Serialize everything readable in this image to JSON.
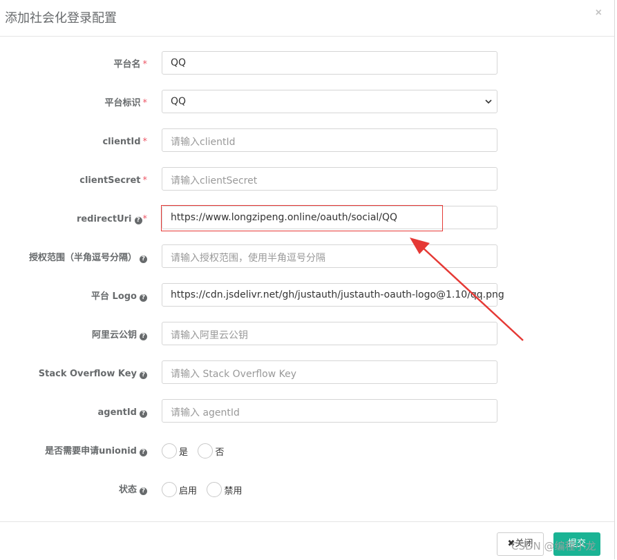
{
  "modal": {
    "title": "添加社会化登录配置",
    "close_symbol": "×"
  },
  "fields": {
    "platform_name": {
      "label": "平台名",
      "value": "QQ"
    },
    "platform_id": {
      "label": "平台标识",
      "value": "QQ"
    },
    "client_id": {
      "label": "clientId",
      "placeholder": "请输入clientId"
    },
    "client_secret": {
      "label": "clientSecret",
      "placeholder": "请输入clientSecret"
    },
    "redirect_uri": {
      "label": "redirectUri",
      "value": "https://www.longzipeng.online/oauth/social/QQ"
    },
    "scope": {
      "label": "授权范围（半角逗号分隔）",
      "placeholder": "请输入授权范围，使用半角逗号分隔"
    },
    "logo": {
      "label": "平台 Logo",
      "value": "https://cdn.jsdelivr.net/gh/justauth/justauth-oauth-logo@1.10/qq.png"
    },
    "alipay_key": {
      "label": "阿里云公钥",
      "placeholder": "请输入阿里云公钥"
    },
    "stackoverflow_key": {
      "label": "Stack Overflow Key",
      "placeholder": "请输入 Stack Overflow Key"
    },
    "agent_id": {
      "label": "agentId",
      "placeholder": "请输入 agentId"
    },
    "need_unionid": {
      "label": "是否需要申请unionid",
      "options": [
        "是",
        "否"
      ]
    },
    "status": {
      "label": "状态",
      "options": [
        "启用",
        "禁用"
      ]
    }
  },
  "required_mark": "*",
  "help_symbol": "?",
  "footer": {
    "close_label": "✖关闭",
    "submit_label": "提交"
  },
  "watermark": "CSDN @编程小龙",
  "colors": {
    "primary": "#1ab394",
    "required": "#ed5565",
    "annotation": "#e53935"
  }
}
